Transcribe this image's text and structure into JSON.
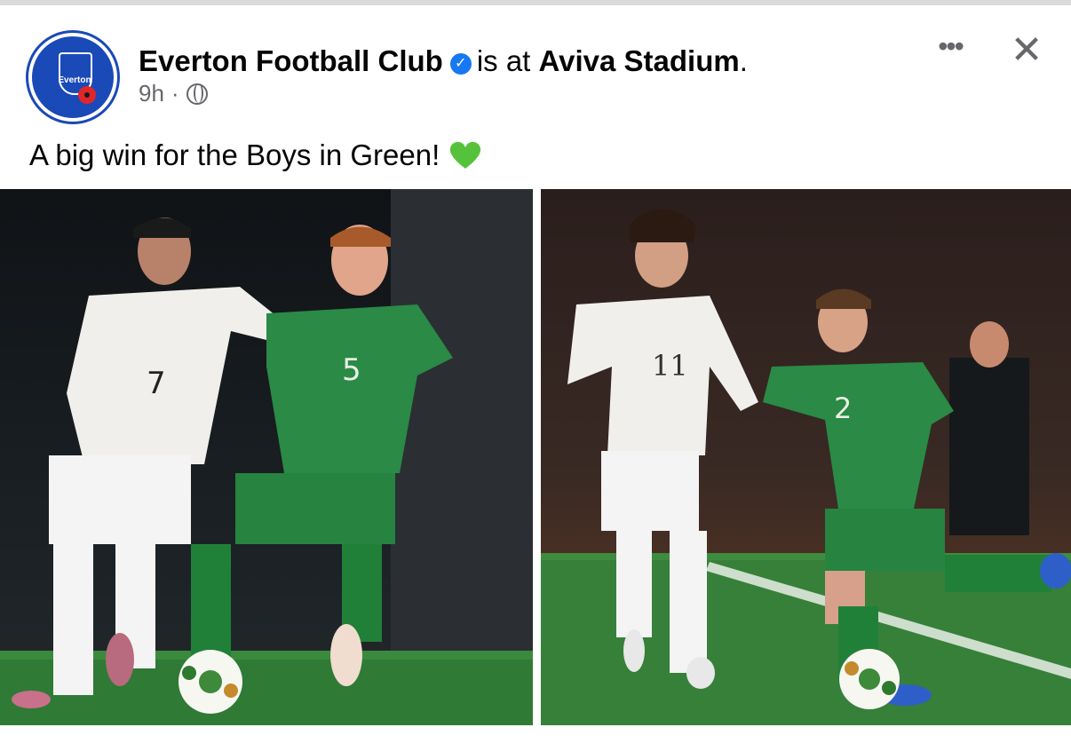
{
  "post": {
    "author": "Everton Football Club",
    "verified_icon": "verified-badge-icon",
    "location_prefix": "is at",
    "location": "Aviva Stadium",
    "location_suffix": ".",
    "time": "9h",
    "separator": "·",
    "audience_icon": "globe-icon",
    "caption": "A big win for the Boys in Green!",
    "caption_emoji": "green-heart-icon",
    "avatar_text": "Everton"
  },
  "header_actions": {
    "more_label": "•••",
    "close_label": "✕"
  },
  "photos": [
    {
      "jersey_white": "7",
      "jersey_green": "5"
    },
    {
      "jersey_white": "11",
      "jersey_green": "2"
    }
  ],
  "colors": {
    "verified_blue": "#1877f2",
    "avatar_blue": "#1a49b8",
    "ireland_green": "#1f8a3e",
    "meta_gray": "#65676b"
  }
}
